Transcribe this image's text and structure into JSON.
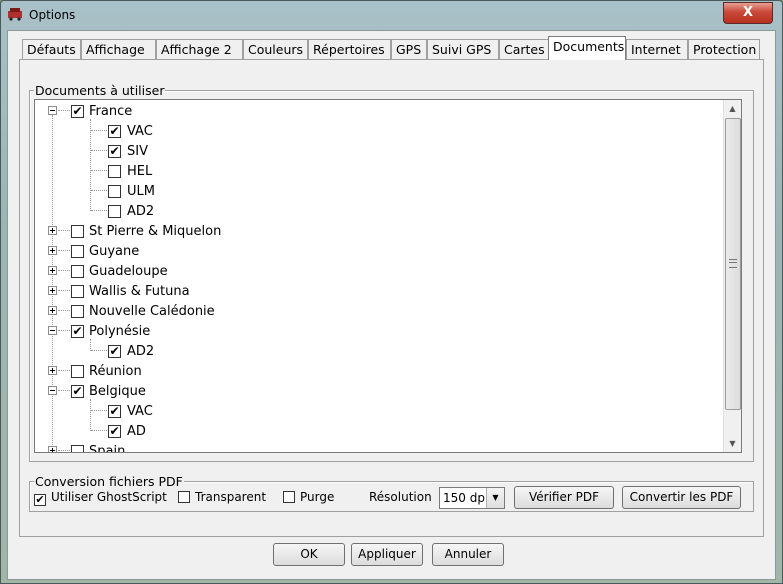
{
  "window": {
    "title": "Options",
    "close_symbol": "X"
  },
  "tabs": [
    {
      "label": "Défauts",
      "active": false
    },
    {
      "label": "Affichage",
      "active": false
    },
    {
      "label": "Affichage 2",
      "active": false
    },
    {
      "label": "Couleurs",
      "active": false
    },
    {
      "label": "Répertoires",
      "active": false
    },
    {
      "label": "GPS",
      "active": false
    },
    {
      "label": "Suivi GPS",
      "active": false
    },
    {
      "label": "Cartes",
      "active": false
    },
    {
      "label": "Documents",
      "active": true
    },
    {
      "label": "Internet",
      "active": false
    },
    {
      "label": "Protection",
      "active": false
    }
  ],
  "documents_group": {
    "label": "Documents à utiliser",
    "tree": [
      {
        "label": "France",
        "level": 0,
        "expander": "minus",
        "checked": true
      },
      {
        "label": "VAC",
        "level": 1,
        "checked": true
      },
      {
        "label": "SIV",
        "level": 1,
        "checked": true
      },
      {
        "label": "HEL",
        "level": 1,
        "checked": false
      },
      {
        "label": "ULM",
        "level": 1,
        "checked": false
      },
      {
        "label": "AD2",
        "level": 1,
        "checked": false
      },
      {
        "label": "St Pierre & Miquelon",
        "level": 0,
        "expander": "plus",
        "checked": false
      },
      {
        "label": "Guyane",
        "level": 0,
        "expander": "plus",
        "checked": false
      },
      {
        "label": "Guadeloupe",
        "level": 0,
        "expander": "plus",
        "checked": false
      },
      {
        "label": "Wallis & Futuna",
        "level": 0,
        "expander": "plus",
        "checked": false
      },
      {
        "label": "Nouvelle Calédonie",
        "level": 0,
        "expander": "plus",
        "checked": false
      },
      {
        "label": "Polynésie",
        "level": 0,
        "expander": "minus",
        "checked": true
      },
      {
        "label": "AD2",
        "level": 1,
        "checked": true
      },
      {
        "label": "Réunion",
        "level": 0,
        "expander": "plus",
        "checked": false
      },
      {
        "label": "Belgique",
        "level": 0,
        "expander": "minus",
        "checked": true
      },
      {
        "label": "VAC",
        "level": 1,
        "checked": true
      },
      {
        "label": "AD",
        "level": 1,
        "checked": true
      },
      {
        "label": "Spain",
        "level": 0,
        "expander": "plus",
        "checked": false
      }
    ],
    "scroll_up": "▲",
    "scroll_down": "▼"
  },
  "pdf_group": {
    "label": "Conversion fichiers PDF",
    "use_ghostscript": {
      "label": "Utiliser GhostScript",
      "checked": true
    },
    "transparent": {
      "label": "Transparent",
      "checked": false
    },
    "purge": {
      "label": "Purge",
      "checked": false
    },
    "resolution_label": "Résolution",
    "resolution_value": "150 dpi",
    "verify_button": "Vérifier PDF",
    "convert_button": "Convertir les PDF"
  },
  "footer": {
    "ok": "OK",
    "apply": "Appliquer",
    "cancel": "Annuler"
  },
  "check_mark": "✔"
}
